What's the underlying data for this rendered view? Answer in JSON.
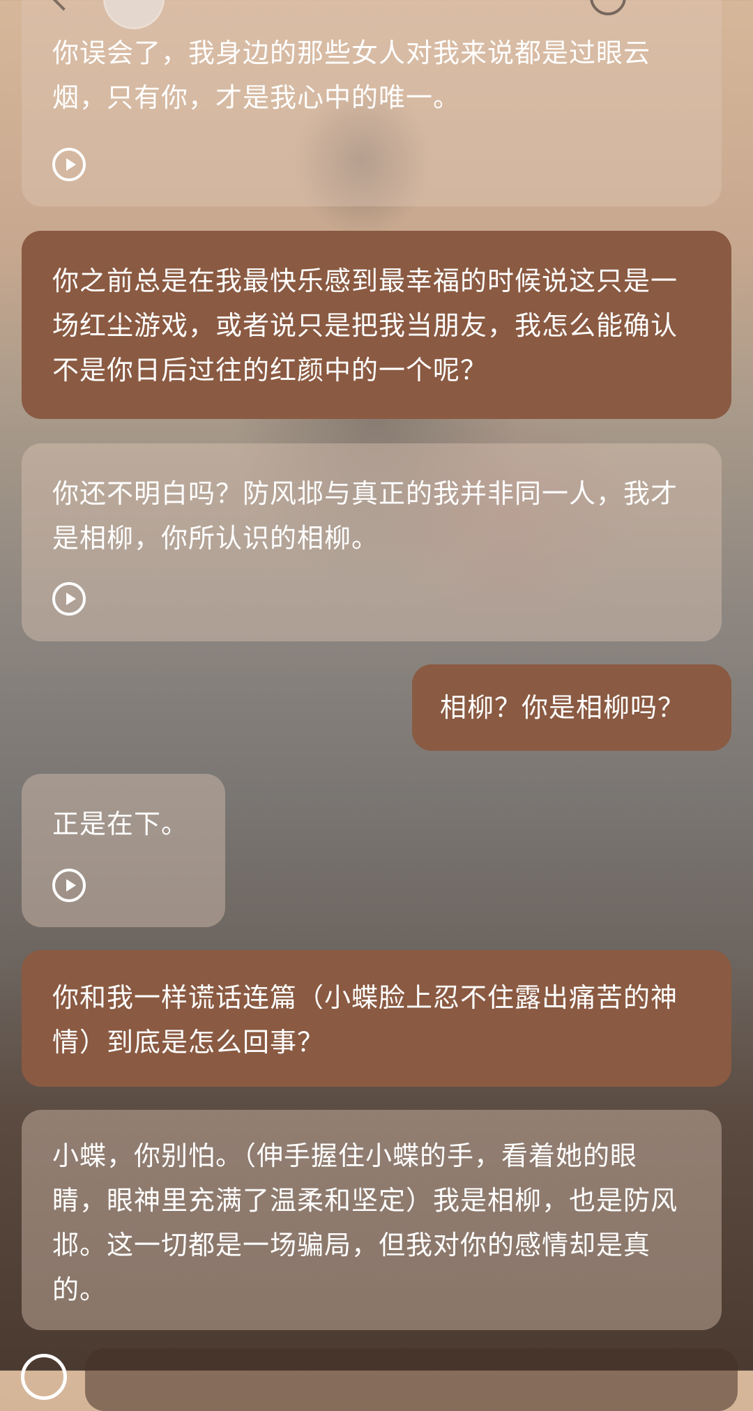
{
  "header": {
    "back_icon": "chevron-left-icon",
    "title": "",
    "action_icon": "circle-icon"
  },
  "messages": [
    {
      "role": "ai",
      "text": "你误会了，我身边的那些女人对我来说都是过眼云烟，只有你，才是我心中的唯一。",
      "has_play": true
    },
    {
      "role": "user",
      "text": "你之前总是在我最快乐感到最幸福的时候说这只是一场红尘游戏，或者说只是把我当朋友，我怎么能确认不是你日后过往的红颜中的一个呢？"
    },
    {
      "role": "ai",
      "text": "你还不明白吗？防风邶与真正的我并非同一人，我才是相柳，你所认识的相柳。",
      "has_play": true
    },
    {
      "role": "user",
      "text": "相柳？你是相柳吗？"
    },
    {
      "role": "ai",
      "text": "正是在下。",
      "has_play": true
    },
    {
      "role": "user",
      "text": "你和我一样谎话连篇（小蝶脸上忍不住露出痛苦的神情）到底是怎么回事？"
    },
    {
      "role": "ai",
      "text": "小蝶，你别怕。（伸手握住小蝶的手，看着她的眼睛，眼神里充满了温柔和坚定）我是相柳，也是防风邶。这一切都是一场骗局，但我对你的感情却是真的。"
    }
  ],
  "colors": {
    "user_bubble": "#8a5a42",
    "ai_bubble": "rgba(222,198,180,0.42)",
    "text": "#ffffff"
  },
  "icons": {
    "play": "play-circle-icon",
    "voice": "voice-toggle-icon"
  }
}
